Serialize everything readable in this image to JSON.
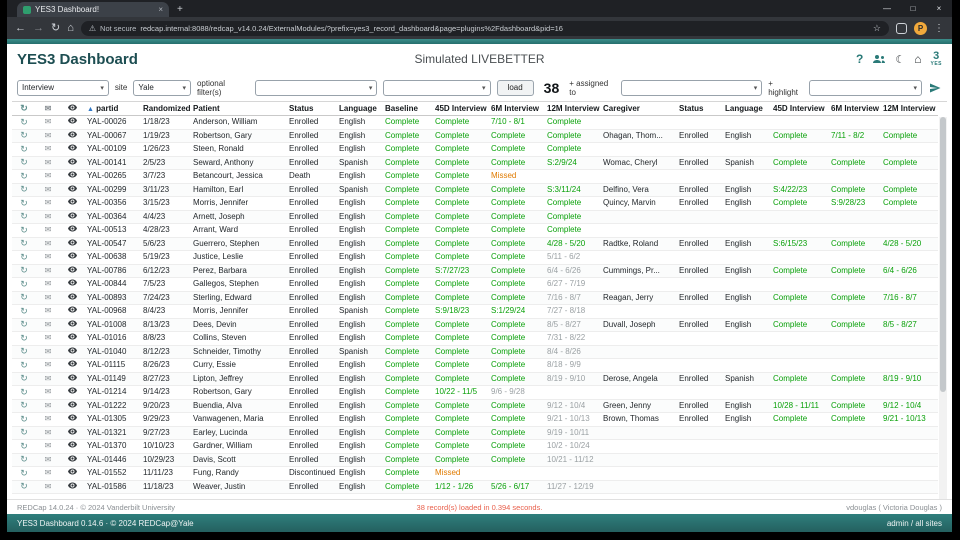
{
  "colors": {
    "teal": "#2a7a78",
    "green": "#0aa10a",
    "orange": "#e07b00",
    "red": "#e8604c"
  },
  "icons": {
    "refresh": "↻",
    "mail": "✉",
    "back": "←",
    "forward": "→",
    "reload": "↻",
    "browser_home": "⌂",
    "warning": "⚠",
    "star": "☆",
    "menu": "⋮",
    "help": "?",
    "moon": "☾",
    "home": "⌂",
    "select_caret": "▾",
    "new_tab": "+",
    "tab_close": "×",
    "win_min": "—",
    "win_max": "□",
    "win_close": "×"
  },
  "browser": {
    "tab_title": "YES3 Dashboard!",
    "security_label": "Not secure",
    "url": "redcap.internal:8088/redcap_v14.0.24/ExternalModules/?prefix=yes3_record_dashboard&page=plugins%2Fdashboard&pid=16",
    "profile_initial": "P"
  },
  "header": {
    "app_title": "YES3 Dashboard",
    "page_title": "Simulated LIVEBETTER",
    "logo_number": "3",
    "logo_text": "YES"
  },
  "filters": {
    "cohort_value": "Interview",
    "site_label": "site",
    "site_value": "Yale",
    "optional_label": "optional filter(s)",
    "filter1_value": "",
    "filter2_value": "",
    "load_label": "load",
    "record_count": "38",
    "assigned_label": "+ assigned to",
    "assigned_value": "",
    "highlight_label": "+ highlight",
    "highlight_value": ""
  },
  "table": {
    "sort_icon": "▲",
    "columns": [
      "partid",
      "Randomized",
      "Patient",
      "Status",
      "Language",
      "Baseline",
      "45D Interview",
      "6M Interview",
      "12M Interview",
      "Caregiver",
      "Status",
      "Language",
      "45D Interview",
      "6M Interview",
      "12M Interview"
    ],
    "rows": [
      [
        "YAL-00026",
        "1/18/23",
        "Anderson, William",
        "Enrolled",
        "English",
        [
          "Complete",
          "ok"
        ],
        [
          "Complete",
          "ok"
        ],
        [
          "7/10 - 8/1",
          "wgr"
        ],
        [
          "Complete",
          "ok"
        ],
        "",
        "",
        "",
        [
          "",
          ""
        ],
        [
          "",
          ""
        ],
        [
          "",
          ""
        ]
      ],
      [
        "YAL-00067",
        "1/19/23",
        "Robertson, Gary",
        "Enrolled",
        "English",
        [
          "Complete",
          "ok"
        ],
        [
          "Complete",
          "ok"
        ],
        [
          "Complete",
          "ok"
        ],
        [
          "Complete",
          "ok"
        ],
        "Ohagan, Thom...",
        "Enrolled",
        "English",
        [
          "Complete",
          "ok"
        ],
        [
          "7/11 - 8/2",
          "wgr"
        ],
        [
          "Complete",
          "ok"
        ]
      ],
      [
        "YAL-00109",
        "1/26/23",
        "Steen, Ronald",
        "Enrolled",
        "English",
        [
          "Complete",
          "ok"
        ],
        [
          "Complete",
          "ok"
        ],
        [
          "Complete",
          "ok"
        ],
        [
          "Complete",
          "ok"
        ],
        "",
        "",
        "",
        [
          "",
          ""
        ],
        [
          "",
          ""
        ],
        [
          "",
          ""
        ]
      ],
      [
        "YAL-00141",
        "2/5/23",
        "Seward, Anthony",
        "Enrolled",
        "Spanish",
        [
          "Complete",
          "ok"
        ],
        [
          "Complete",
          "ok"
        ],
        [
          "Complete",
          "ok"
        ],
        [
          "S:2/9/24",
          "s"
        ],
        "Womac, Cheryl",
        "Enrolled",
        "Spanish",
        [
          "Complete",
          "ok"
        ],
        [
          "Complete",
          "ok"
        ],
        [
          "Complete",
          "ok"
        ]
      ],
      [
        "YAL-00265",
        "3/7/23",
        "Betancourt, Jessica",
        "Death",
        "English",
        [
          "Complete",
          "ok"
        ],
        [
          "Complete",
          "ok"
        ],
        [
          "Missed",
          "m"
        ],
        [
          "",
          ""
        ],
        "",
        "",
        "",
        [
          "",
          ""
        ],
        [
          "",
          ""
        ],
        [
          "",
          ""
        ]
      ],
      [
        "YAL-00299",
        "3/11/23",
        "Hamilton, Earl",
        "Enrolled",
        "Spanish",
        [
          "Complete",
          "ok"
        ],
        [
          "Complete",
          "ok"
        ],
        [
          "Complete",
          "ok"
        ],
        [
          "S:3/11/24",
          "s"
        ],
        "Delfino, Vera",
        "Enrolled",
        "English",
        [
          "S:4/22/23",
          "s"
        ],
        [
          "Complete",
          "ok"
        ],
        [
          "Complete",
          "ok"
        ]
      ],
      [
        "YAL-00356",
        "3/15/23",
        "Morris, Jennifer",
        "Enrolled",
        "English",
        [
          "Complete",
          "ok"
        ],
        [
          "Complete",
          "ok"
        ],
        [
          "Complete",
          "ok"
        ],
        [
          "Complete",
          "ok"
        ],
        "Quincy, Marvin",
        "Enrolled",
        "English",
        [
          "Complete",
          "ok"
        ],
        [
          "S:9/28/23",
          "s"
        ],
        [
          "Complete",
          "ok"
        ]
      ],
      [
        "YAL-00364",
        "4/4/23",
        "Arnett, Joseph",
        "Enrolled",
        "English",
        [
          "Complete",
          "ok"
        ],
        [
          "Complete",
          "ok"
        ],
        [
          "Complete",
          "ok"
        ],
        [
          "Complete",
          "ok"
        ],
        "",
        "",
        "",
        [
          "",
          ""
        ],
        [
          "",
          ""
        ],
        [
          "",
          ""
        ]
      ],
      [
        "YAL-00513",
        "4/28/23",
        "Arrant, Ward",
        "Enrolled",
        "English",
        [
          "Complete",
          "ok"
        ],
        [
          "Complete",
          "ok"
        ],
        [
          "Complete",
          "ok"
        ],
        [
          "Complete",
          "ok"
        ],
        "",
        "",
        "",
        [
          "",
          ""
        ],
        [
          "",
          ""
        ],
        [
          "",
          ""
        ]
      ],
      [
        "YAL-00547",
        "5/6/23",
        "Guerrero, Stephen",
        "Enrolled",
        "English",
        [
          "Complete",
          "ok"
        ],
        [
          "Complete",
          "ok"
        ],
        [
          "Complete",
          "ok"
        ],
        [
          "4/28 - 5/20",
          "wgr"
        ],
        "Radtke, Roland",
        "Enrolled",
        "English",
        [
          "S:6/15/23",
          "s"
        ],
        [
          "Complete",
          "ok"
        ],
        [
          "4/28 - 5/20",
          "wgr"
        ]
      ],
      [
        "YAL-00638",
        "5/19/23",
        "Justice, Leslie",
        "Enrolled",
        "English",
        [
          "Complete",
          "ok"
        ],
        [
          "Complete",
          "ok"
        ],
        [
          "Complete",
          "ok"
        ],
        [
          "5/11 - 6/2",
          "wg"
        ],
        "",
        "",
        "",
        [
          "",
          ""
        ],
        [
          "",
          ""
        ],
        [
          "",
          ""
        ]
      ],
      [
        "YAL-00786",
        "6/12/23",
        "Perez, Barbara",
        "Enrolled",
        "English",
        [
          "Complete",
          "ok"
        ],
        [
          "S:7/27/23",
          "s"
        ],
        [
          "Complete",
          "ok"
        ],
        [
          "6/4 - 6/26",
          "wg"
        ],
        "Cummings, Pr...",
        "Enrolled",
        "English",
        [
          "Complete",
          "ok"
        ],
        [
          "Complete",
          "ok"
        ],
        [
          "6/4 - 6/26",
          "wgr"
        ]
      ],
      [
        "YAL-00844",
        "7/5/23",
        "Gallegos, Stephen",
        "Enrolled",
        "English",
        [
          "Complete",
          "ok"
        ],
        [
          "Complete",
          "ok"
        ],
        [
          "Complete",
          "ok"
        ],
        [
          "6/27 - 7/19",
          "wg"
        ],
        "",
        "",
        "",
        [
          "",
          ""
        ],
        [
          "",
          ""
        ],
        [
          "",
          ""
        ]
      ],
      [
        "YAL-00893",
        "7/24/23",
        "Sterling, Edward",
        "Enrolled",
        "English",
        [
          "Complete",
          "ok"
        ],
        [
          "Complete",
          "ok"
        ],
        [
          "Complete",
          "ok"
        ],
        [
          "7/16 - 8/7",
          "wg"
        ],
        "Reagan, Jerry",
        "Enrolled",
        "English",
        [
          "Complete",
          "ok"
        ],
        [
          "Complete",
          "ok"
        ],
        [
          "7/16 - 8/7",
          "wgr"
        ]
      ],
      [
        "YAL-00968",
        "8/4/23",
        "Morris, Jennifer",
        "Enrolled",
        "Spanish",
        [
          "Complete",
          "ok"
        ],
        [
          "S:9/18/23",
          "s"
        ],
        [
          "S:1/29/24",
          "s"
        ],
        [
          "7/27 - 8/18",
          "wg"
        ],
        "",
        "",
        "",
        [
          "",
          ""
        ],
        [
          "",
          ""
        ],
        [
          "",
          ""
        ]
      ],
      [
        "YAL-01008",
        "8/13/23",
        "Dees, Devin",
        "Enrolled",
        "English",
        [
          "Complete",
          "ok"
        ],
        [
          "Complete",
          "ok"
        ],
        [
          "Complete",
          "ok"
        ],
        [
          "8/5 - 8/27",
          "wg"
        ],
        "Duvall, Joseph",
        "Enrolled",
        "English",
        [
          "Complete",
          "ok"
        ],
        [
          "Complete",
          "ok"
        ],
        [
          "8/5 - 8/27",
          "wgr"
        ]
      ],
      [
        "YAL-01016",
        "8/8/23",
        "Collins, Steven",
        "Enrolled",
        "English",
        [
          "Complete",
          "ok"
        ],
        [
          "Complete",
          "ok"
        ],
        [
          "Complete",
          "ok"
        ],
        [
          "7/31 - 8/22",
          "wg"
        ],
        "",
        "",
        "",
        [
          "",
          ""
        ],
        [
          "",
          ""
        ],
        [
          "",
          ""
        ]
      ],
      [
        "YAL-01040",
        "8/12/23",
        "Schneider, Timothy",
        "Enrolled",
        "Spanish",
        [
          "Complete",
          "ok"
        ],
        [
          "Complete",
          "ok"
        ],
        [
          "Complete",
          "ok"
        ],
        [
          "8/4 - 8/26",
          "wg"
        ],
        "",
        "",
        "",
        [
          "",
          ""
        ],
        [
          "",
          ""
        ],
        [
          "",
          ""
        ]
      ],
      [
        "YAL-01115",
        "8/26/23",
        "Curry, Essie",
        "Enrolled",
        "English",
        [
          "Complete",
          "ok"
        ],
        [
          "Complete",
          "ok"
        ],
        [
          "Complete",
          "ok"
        ],
        [
          "8/18 - 9/9",
          "wg"
        ],
        "",
        "",
        "",
        [
          "",
          ""
        ],
        [
          "",
          ""
        ],
        [
          "",
          ""
        ]
      ],
      [
        "YAL-01149",
        "8/27/23",
        "Lipton, Jeffrey",
        "Enrolled",
        "English",
        [
          "Complete",
          "ok"
        ],
        [
          "Complete",
          "ok"
        ],
        [
          "Complete",
          "ok"
        ],
        [
          "8/19 - 9/10",
          "wg"
        ],
        "Derose, Angela",
        "Enrolled",
        "Spanish",
        [
          "Complete",
          "ok"
        ],
        [
          "Complete",
          "ok"
        ],
        [
          "8/19 - 9/10",
          "wgr"
        ]
      ],
      [
        "YAL-01214",
        "9/14/23",
        "Robertson, Gary",
        "Enrolled",
        "English",
        [
          "Complete",
          "ok"
        ],
        [
          "10/22 - 11/5",
          "wgr"
        ],
        [
          "9/6 - 9/28",
          "wg"
        ],
        [
          "",
          ""
        ],
        "",
        "",
        "",
        [
          "",
          ""
        ],
        [
          "",
          ""
        ],
        [
          "",
          ""
        ]
      ],
      [
        "YAL-01222",
        "9/20/23",
        "Buendia, Alva",
        "Enrolled",
        "English",
        [
          "Complete",
          "ok"
        ],
        [
          "Complete",
          "ok"
        ],
        [
          "Complete",
          "ok"
        ],
        [
          "9/12 - 10/4",
          "wg"
        ],
        "Green, Jenny",
        "Enrolled",
        "English",
        [
          "10/28 - 11/11",
          "wgr"
        ],
        [
          "Complete",
          "ok"
        ],
        [
          "9/12 - 10/4",
          "wgr"
        ]
      ],
      [
        "YAL-01305",
        "9/29/23",
        "Vanwagenen, Maria",
        "Enrolled",
        "English",
        [
          "Complete",
          "ok"
        ],
        [
          "Complete",
          "ok"
        ],
        [
          "Complete",
          "ok"
        ],
        [
          "9/21 - 10/13",
          "wg"
        ],
        "Brown, Thomas",
        "Enrolled",
        "English",
        [
          "Complete",
          "ok"
        ],
        [
          "Complete",
          "ok"
        ],
        [
          "9/21 - 10/13",
          "wgr"
        ]
      ],
      [
        "YAL-01321",
        "9/27/23",
        "Earley, Lucinda",
        "Enrolled",
        "English",
        [
          "Complete",
          "ok"
        ],
        [
          "Complete",
          "ok"
        ],
        [
          "Complete",
          "ok"
        ],
        [
          "9/19 - 10/11",
          "wg"
        ],
        "",
        "",
        "",
        [
          "",
          ""
        ],
        [
          "",
          ""
        ],
        [
          "",
          ""
        ]
      ],
      [
        "YAL-01370",
        "10/10/23",
        "Gardner, William",
        "Enrolled",
        "English",
        [
          "Complete",
          "ok"
        ],
        [
          "Complete",
          "ok"
        ],
        [
          "Complete",
          "ok"
        ],
        [
          "10/2 - 10/24",
          "wg"
        ],
        "",
        "",
        "",
        [
          "",
          ""
        ],
        [
          "",
          ""
        ],
        [
          "",
          ""
        ]
      ],
      [
        "YAL-01446",
        "10/29/23",
        "Davis, Scott",
        "Enrolled",
        "English",
        [
          "Complete",
          "ok"
        ],
        [
          "Complete",
          "ok"
        ],
        [
          "Complete",
          "ok"
        ],
        [
          "10/21 - 11/12",
          "wg"
        ],
        "",
        "",
        "",
        [
          "",
          ""
        ],
        [
          "",
          ""
        ],
        [
          "",
          ""
        ]
      ],
      [
        "YAL-01552",
        "11/11/23",
        "Fung, Randy",
        "Discontinued",
        "English",
        [
          "Complete",
          "ok"
        ],
        [
          "Missed",
          "m"
        ],
        [
          "",
          ""
        ],
        [
          "",
          ""
        ],
        "",
        "",
        "",
        [
          "",
          ""
        ],
        [
          "",
          ""
        ],
        [
          "",
          ""
        ]
      ],
      [
        "YAL-01586",
        "11/18/23",
        "Weaver, Justin",
        "Enrolled",
        "English",
        [
          "Complete",
          "ok"
        ],
        [
          "1/12 - 1/26",
          "wgr"
        ],
        [
          "5/26 - 6/17",
          "wgr"
        ],
        [
          "11/27 - 12/19",
          "wg"
        ],
        "",
        "",
        "",
        [
          "",
          ""
        ],
        [
          "",
          ""
        ],
        [
          "",
          ""
        ]
      ]
    ]
  },
  "footer": {
    "redcap_version": "REDCap 14.0.24 · © 2024 Vanderbilt University",
    "load_message": "38 record(s) loaded in 0.394 seconds.",
    "user": "vdouglas ( Victoria Douglas )",
    "module_version": "YES3 Dashboard 0.14.6 · © 2024 REDCap@Yale",
    "role": "admin / all sites"
  }
}
